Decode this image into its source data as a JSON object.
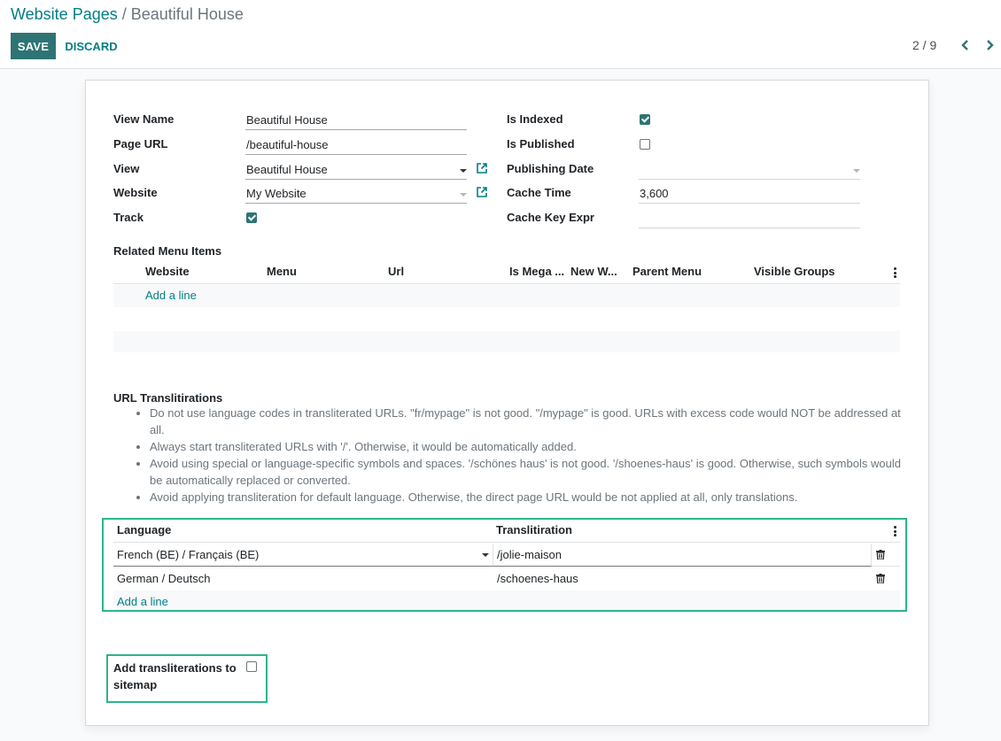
{
  "breadcrumb": {
    "parent": "Website Pages",
    "separator": " / ",
    "current": "Beautiful House"
  },
  "toolbar": {
    "save_label": "SAVE",
    "discard_label": "DISCARD"
  },
  "pager": {
    "value": "2 / 9",
    "prev_icon": "chevron-left-icon",
    "next_icon": "chevron-right-icon"
  },
  "form": {
    "view_name": {
      "label": "View Name",
      "value": "Beautiful House"
    },
    "page_url": {
      "label": "Page URL",
      "value": "/beautiful-house"
    },
    "view": {
      "label": "View",
      "value": "Beautiful House"
    },
    "website": {
      "label": "Website",
      "value": "My Website"
    },
    "track": {
      "label": "Track",
      "checked": true
    },
    "is_indexed": {
      "label": "Is Indexed",
      "checked": true
    },
    "is_published": {
      "label": "Is Published",
      "checked": false
    },
    "publishing_date": {
      "label": "Publishing Date",
      "value": ""
    },
    "cache_time": {
      "label": "Cache Time",
      "value": "3,600"
    },
    "cache_key_expr": {
      "label": "Cache Key Expr",
      "value": ""
    }
  },
  "menu_items": {
    "title": "Related Menu Items",
    "columns": [
      "Website",
      "Menu",
      "Url",
      "Is Mega ...",
      "New W...",
      "Parent Menu",
      "Visible Groups"
    ],
    "add_line": "Add a line"
  },
  "translit": {
    "title": "URL Translitirations",
    "notes": [
      "Do not use language codes in transliterated URLs. \"fr/mypage\" is not good. \"/mypage\" is good. URLs with excess code would NOT be addressed at all.",
      "Always start transliterated URLs with '/'. Otherwise, it would be automatically added.",
      "Avoid using special or language-specific symbols and spaces. '/schönes haus' is not good. '/shoenes-haus' is good. Otherwise, such symbols would be automatically replaced or converted.",
      "Avoid applying transliteration for default language. Otherwise, the direct page URL would be not applied at all, only translations."
    ],
    "columns": [
      "Language",
      "Translitiration"
    ],
    "rows": [
      {
        "language": "French (BE) / Français (BE)",
        "translit": "/jolie-maison"
      },
      {
        "language": "German / Deutsch",
        "translit": "/schoenes-haus"
      }
    ],
    "add_line": "Add a line"
  },
  "sitemap": {
    "label_line1": "Add transliterations to",
    "label_line2": "sitemap",
    "checked": false
  },
  "colors": {
    "brand": "#2e7474",
    "link": "#017e84",
    "highlight": "#2db48d"
  }
}
